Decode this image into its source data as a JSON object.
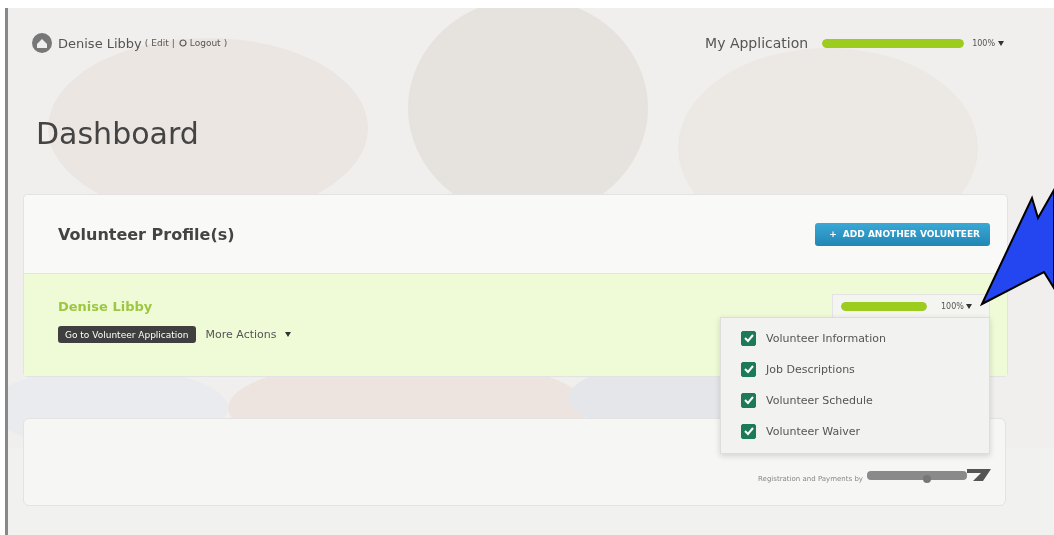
{
  "header": {
    "user_name": "Denise Libby",
    "open_bracket": "(",
    "edit_link": "Edit",
    "separator": "|",
    "logout_link": "Logout",
    "close_bracket": ")",
    "application_label": "My Application",
    "progress": {
      "level": 1,
      "reading": "100%"
    }
  },
  "title": "Dashboard",
  "profiles": {
    "title": "Volunteer Profile(s)",
    "add_icon": "+",
    "add_button": "ADD ANOTHER VOLUNTEER",
    "items": [
      {
        "name": "Denise Libby",
        "primary_button": "Go to Volunteer Application",
        "more_actions": "More Actions",
        "progress": {
          "level": 1,
          "reading": "100%"
        },
        "menu": [
          {
            "label": "Volunteer Information",
            "checked": true
          },
          {
            "label": "Job Descriptions",
            "checked": true
          },
          {
            "label": "Volunteer Schedule",
            "checked": true
          },
          {
            "label": "Volunteer Waiver",
            "checked": true
          }
        ]
      }
    ]
  },
  "footer": {
    "credit": "Registration and Payments by"
  }
}
